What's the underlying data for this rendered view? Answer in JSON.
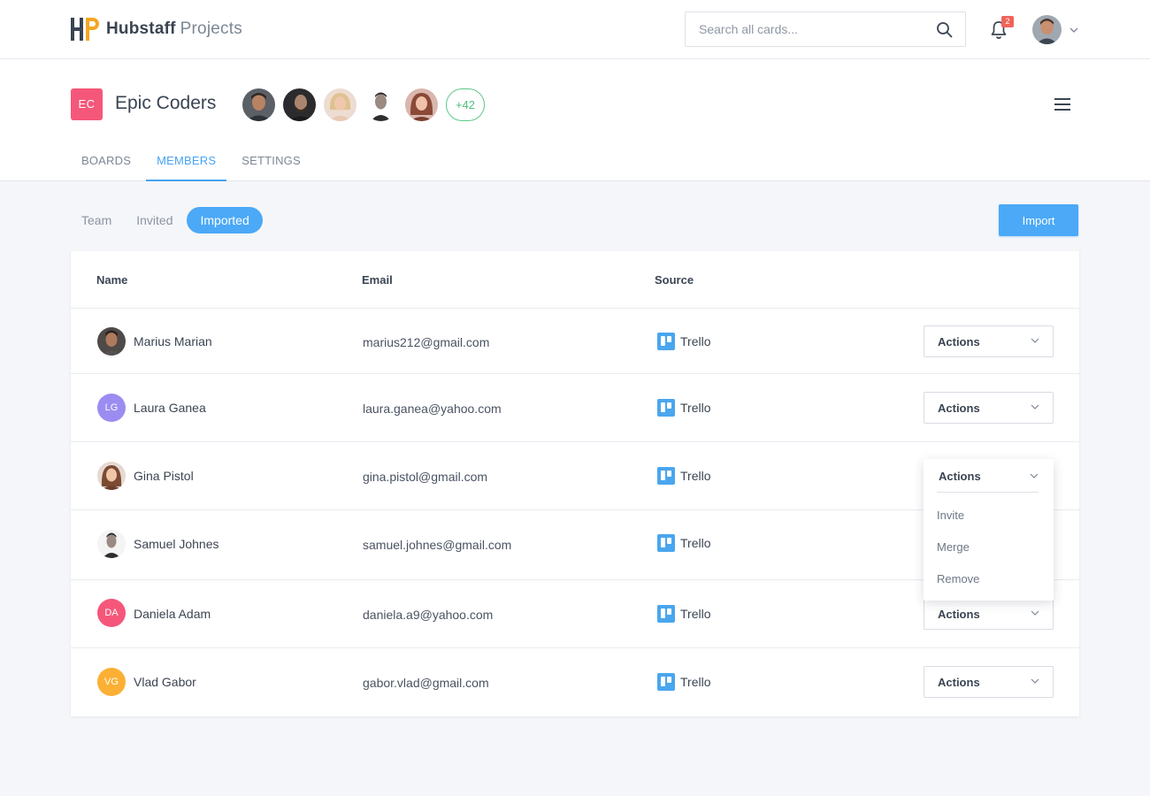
{
  "header": {
    "brand": "Hubstaff",
    "product": "Projects",
    "search_placeholder": "Search all cards...",
    "notification_count": "2"
  },
  "project": {
    "badge": "EC",
    "title": "Epic Coders",
    "more_members": "+42"
  },
  "tabs": [
    {
      "label": "BOARDS",
      "active": false
    },
    {
      "label": "MEMBERS",
      "active": true
    },
    {
      "label": "SETTINGS",
      "active": false
    }
  ],
  "filters": [
    {
      "label": "Team",
      "active": false
    },
    {
      "label": "Invited",
      "active": false
    },
    {
      "label": "Imported",
      "active": true
    }
  ],
  "import_label": "Import",
  "table": {
    "columns": [
      "Name",
      "Email",
      "Source"
    ],
    "rows": [
      {
        "name": "Marius Marian",
        "email": "marius212@gmail.com",
        "source": "Trello",
        "initials": "",
        "avatar_color": ""
      },
      {
        "name": "Laura Ganea",
        "email": "laura.ganea@yahoo.com",
        "source": "Trello",
        "initials": "LG",
        "avatar_color": "#9b8cf2"
      },
      {
        "name": "Gina Pistol",
        "email": "gina.pistol@gmail.com",
        "source": "Trello",
        "initials": "",
        "avatar_color": ""
      },
      {
        "name": "Samuel Johnes",
        "email": "samuel.johnes@gmail.com",
        "source": "Trello",
        "initials": "",
        "avatar_color": ""
      },
      {
        "name": "Daniela Adam",
        "email": "daniela.a9@yahoo.com",
        "source": "Trello",
        "initials": "DA",
        "avatar_color": "#f5577a"
      },
      {
        "name": "Vlad Gabor",
        "email": "gabor.vlad@gmail.com",
        "source": "Trello",
        "initials": "VG",
        "avatar_color": "#fbb034"
      }
    ],
    "actions_label": "Actions"
  },
  "dropdown": {
    "label": "Actions",
    "items": [
      "Invite",
      "Merge",
      "Remove"
    ]
  },
  "colors": {
    "accent": "#4ba9f7",
    "project_badge": "#f5577a",
    "more_members": "#5dc78a",
    "notification": "#f0645a",
    "trello": "#4aa6ee"
  }
}
